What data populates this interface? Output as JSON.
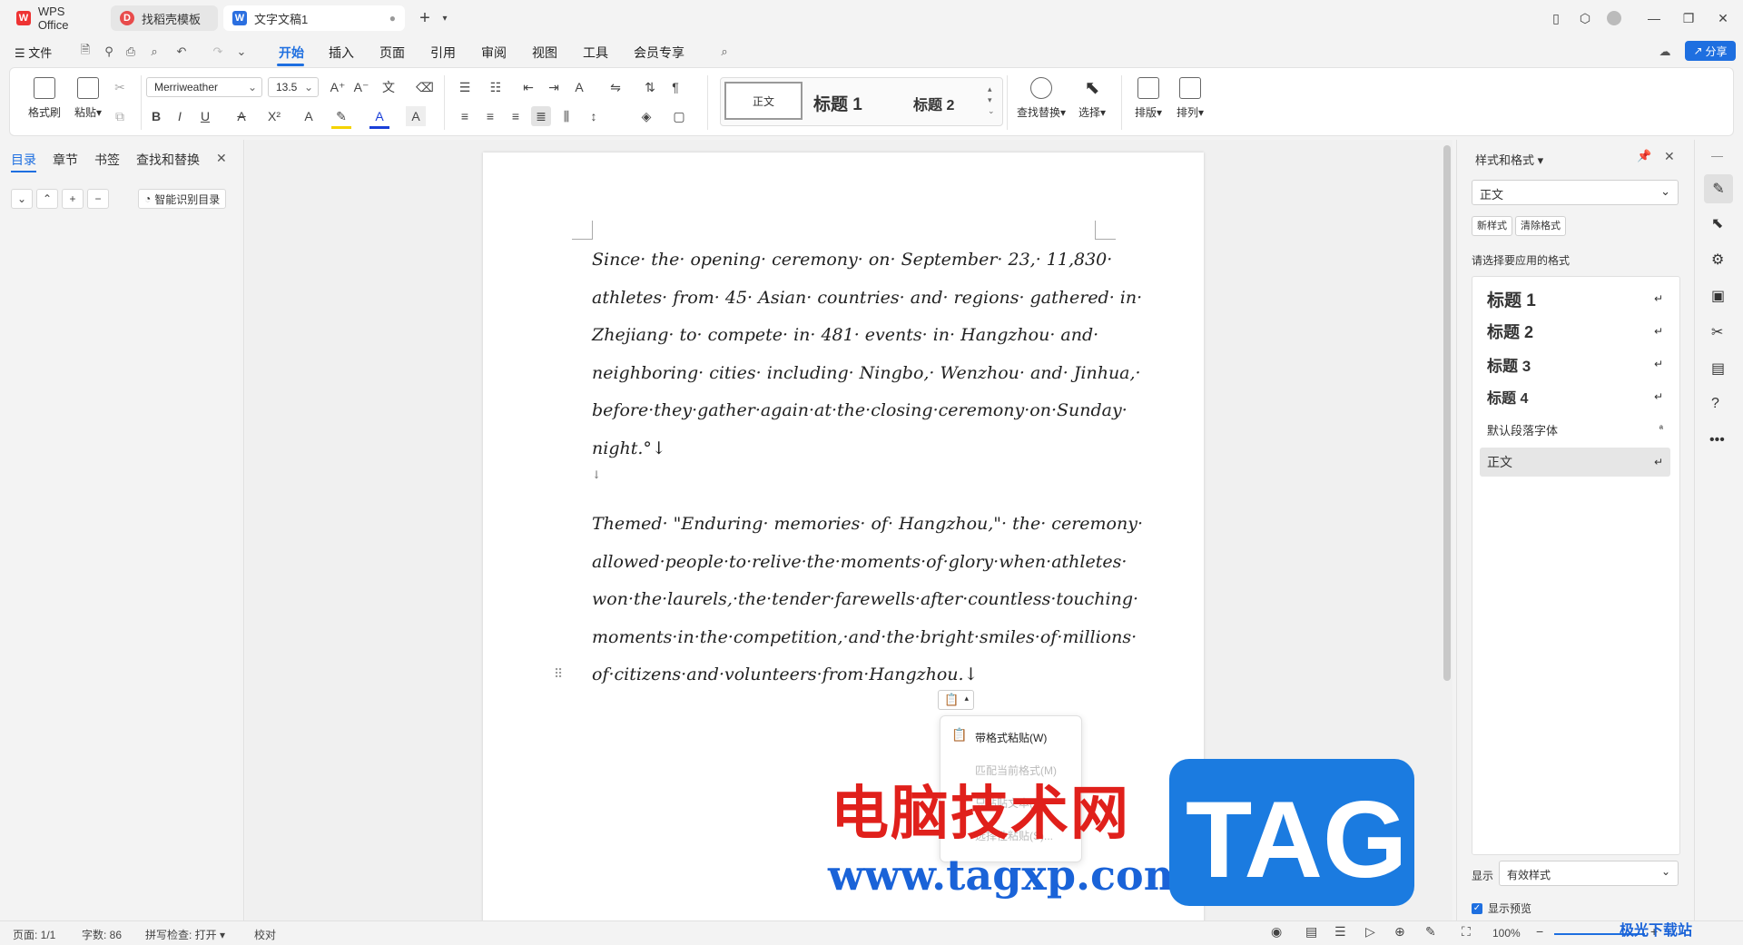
{
  "tabs": [
    {
      "label": "WPS Office"
    },
    {
      "label": "找稻壳模板"
    },
    {
      "label": "文字文稿1"
    }
  ],
  "menu": {
    "file": "文件",
    "items": [
      "开始",
      "插入",
      "页面",
      "引用",
      "审阅",
      "视图",
      "工具",
      "会员专享"
    ],
    "active": "开始",
    "share": "分享"
  },
  "ribbon": {
    "format_painter": "格式刷",
    "paste": "粘贴",
    "font": "Merriweather",
    "font_size": "13.5",
    "style_normal": "正文",
    "style_h1": "标题  1",
    "style_h2": "标题  2",
    "find_replace": "查找替换",
    "select": "选择",
    "typeset": "排版",
    "arrange": "排列"
  },
  "left_panel": {
    "tabs": [
      "目录",
      "章节",
      "书签",
      "查找和替换"
    ],
    "active": "目录",
    "smart_toc": "智能识别目录"
  },
  "document": {
    "para1": [
      "Since· the· opening· ceremony· on· September· 23,· 11,830·",
      "athletes· from· 45· Asian· countries· and· regions· gathered· in·",
      "Zhejiang· to· compete· in· 481· events· in· Hangzhou· and·",
      "neighboring· cities· including· Ningbo,· Wenzhou· and· Jinhua,·",
      "before·they·gather·again·at·the·closing·ceremony·on·Sunday·",
      "night.°↓"
    ],
    "blank": "↓",
    "para2": [
      "Themed· \"Enduring· memories· of· Hangzhou,\"· the· ceremony·",
      "allowed·people·to·relive·the·moments·of·glory·when·athletes·",
      "won·the·laurels,·the·tender·farewells·after·countless·touching·",
      "moments·in·the·competition,·and·the·bright·smiles·of·millions·",
      "of·citizens·and·volunteers·from·Hangzhou.↓"
    ]
  },
  "paste_menu": {
    "items": [
      "带格式粘贴(W)",
      "匹配当前格式(M)",
      "只粘贴文本(T)",
      "选择性粘贴(S)..."
    ]
  },
  "right_panel": {
    "title": "样式和格式",
    "current": "正文",
    "new_style": "新样式",
    "clear_format": "清除格式",
    "prompt": "请选择要应用的格式",
    "styles": [
      "标题  1",
      "标题  2",
      "标题  3",
      "标题  4",
      "默认段落字体",
      "正文"
    ],
    "show_label": "显示",
    "show_value": "有效样式",
    "preview": "显示预览"
  },
  "status": {
    "page": "页面: 1/1",
    "words": "字数: 86",
    "spell": "拼写检查: 打开",
    "proof": "校对",
    "zoom": "100%"
  },
  "watermark": {
    "cn": "电脑技术网",
    "url": "www.tagxp.com",
    "tag": "TAG",
    "corner": "极光下载站"
  }
}
